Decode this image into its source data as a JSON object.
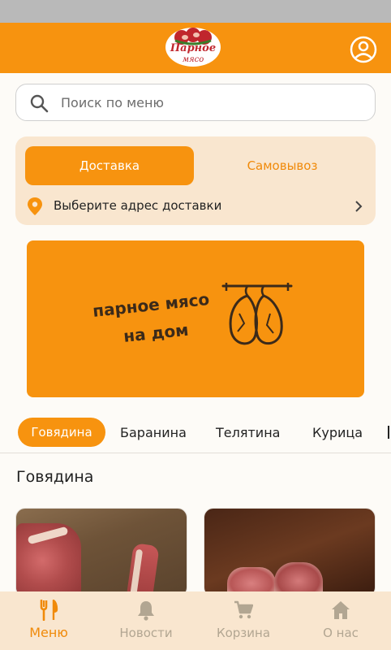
{
  "header": {
    "logo_text": "Парное",
    "logo_subtext": "мясо",
    "profile_icon": "user-circle-icon"
  },
  "search": {
    "placeholder": "Поиск по меню",
    "value": ""
  },
  "delivery_panel": {
    "tabs": [
      {
        "label": "Доставка",
        "active": true
      },
      {
        "label": "Самовывоз",
        "active": false
      }
    ],
    "address_label": "Выберите адрес доставки"
  },
  "banner": {
    "line1": "парное мясо",
    "line2": "на дом"
  },
  "categories": [
    {
      "label": "Говядина",
      "active": true
    },
    {
      "label": "Баранина",
      "active": false
    },
    {
      "label": "Телятина",
      "active": false
    },
    {
      "label": "Курица",
      "active": false
    }
  ],
  "section": {
    "title": "Говядина"
  },
  "bottom_nav": [
    {
      "label": "Меню",
      "icon": "fork-knife-icon",
      "active": true
    },
    {
      "label": "Новости",
      "icon": "bell-icon",
      "active": false
    },
    {
      "label": "Корзина",
      "icon": "cart-icon",
      "active": false
    },
    {
      "label": "О нас",
      "icon": "home-icon",
      "active": false
    }
  ],
  "colors": {
    "accent": "#f7930f",
    "panel": "#f9e6cf",
    "nav_inactive": "#b2a692",
    "logo_red": "#c0262d"
  }
}
